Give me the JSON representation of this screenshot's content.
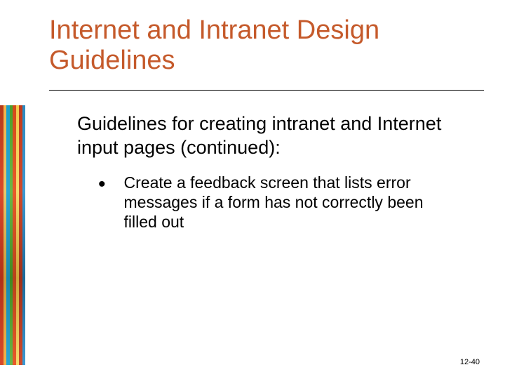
{
  "title": "Internet and Intranet Design Guidelines",
  "lead": "Guidelines for creating intranet and Internet input pages (continued):",
  "bullets": [
    "Create a feedback screen that lists error messages if a form has not correctly been filled out"
  ],
  "page_number": "12-40"
}
